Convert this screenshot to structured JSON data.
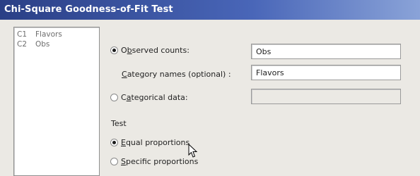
{
  "window": {
    "title": "Chi-Square Goodness-of-Fit Test"
  },
  "variables": [
    {
      "id": "C1",
      "name": "Flavors"
    },
    {
      "id": "C2",
      "name": "Obs"
    }
  ],
  "observed_counts": {
    "label_pre": "O",
    "label_ul": "b",
    "label_post": "served counts:",
    "value": "Obs",
    "selected": true
  },
  "category_names": {
    "label_ul": "C",
    "label_post": "ategory names (optional) :",
    "value": "Flavors"
  },
  "categorical_data": {
    "label_pre": "C",
    "label_ul": "a",
    "label_post": "tegorical data:",
    "value": "",
    "selected": false
  },
  "test": {
    "heading": "Test",
    "equal": {
      "label_ul": "E",
      "label_post": "qual proportions",
      "selected": true
    },
    "specific": {
      "label_ul": "S",
      "label_post": "pecific proportions",
      "selected": false
    }
  }
}
